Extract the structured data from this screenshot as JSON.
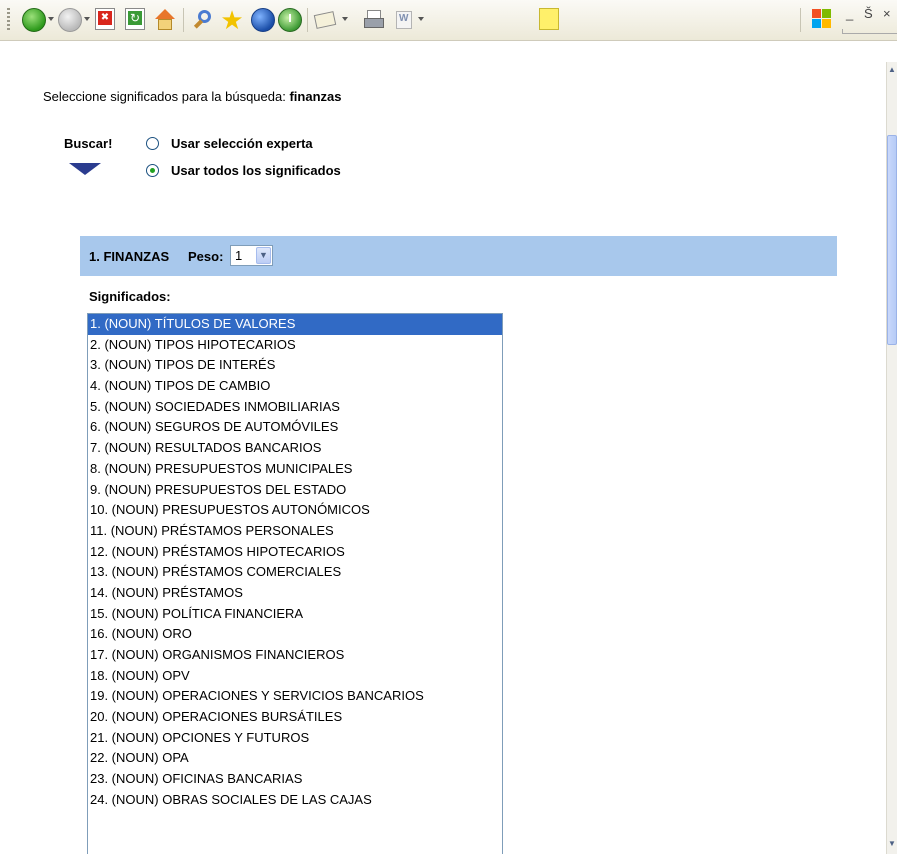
{
  "toolbar": {
    "buttons": [
      {
        "name": "back",
        "icon": "back-arrow-icon"
      },
      {
        "name": "forward",
        "icon": "forward-arrow-icon"
      },
      {
        "name": "stop",
        "icon": "stop-icon"
      },
      {
        "name": "refresh",
        "icon": "refresh-icon"
      },
      {
        "name": "home",
        "icon": "home-icon"
      },
      {
        "name": "search",
        "icon": "search-icon"
      },
      {
        "name": "favorites",
        "icon": "star-icon"
      },
      {
        "name": "media",
        "icon": "media-icon"
      },
      {
        "name": "history",
        "icon": "history-icon"
      },
      {
        "name": "mail",
        "icon": "mail-icon"
      },
      {
        "name": "print",
        "icon": "printer-icon"
      },
      {
        "name": "edit",
        "icon": "word-icon"
      },
      {
        "name": "notes",
        "icon": "note-icon"
      }
    ],
    "window_controls": {
      "minimize": "_",
      "restore": "Š",
      "close": "×"
    }
  },
  "page": {
    "intro_text": "Seleccione significados para la búsqueda: ",
    "query": "finanzas",
    "buscar_label": "Buscar!",
    "options": [
      {
        "label": "Usar selección experta",
        "checked": false
      },
      {
        "label": "Usar todos los significados",
        "checked": true
      }
    ],
    "section": {
      "title": "1. FINANZAS",
      "peso_label": "Peso:",
      "peso_value": "1"
    },
    "significados_label": "Significados:",
    "meanings": [
      "1. (NOUN) TÍTULOS DE VALORES",
      "2. (NOUN) TIPOS HIPOTECARIOS",
      "3. (NOUN) TIPOS DE INTERÉS",
      "4. (NOUN) TIPOS DE CAMBIO",
      "5. (NOUN) SOCIEDADES INMOBILIARIAS",
      "6. (NOUN) SEGUROS DE AUTOMÓVILES",
      "7. (NOUN) RESULTADOS BANCARIOS",
      "8. (NOUN) PRESUPUESTOS MUNICIPALES",
      "9. (NOUN) PRESUPUESTOS DEL ESTADO",
      "10. (NOUN) PRESUPUESTOS AUTONÓMICOS",
      "11. (NOUN) PRÉSTAMOS PERSONALES",
      "12. (NOUN) PRÉSTAMOS HIPOTECARIOS",
      "13. (NOUN) PRÉSTAMOS COMERCIALES",
      "14. (NOUN) PRÉSTAMOS",
      "15. (NOUN) POLÍTICA FINANCIERA",
      "16. (NOUN) ORO",
      "17. (NOUN) ORGANISMOS FINANCIEROS",
      "18. (NOUN) OPV",
      "19. (NOUN) OPERACIONES Y SERVICIOS BANCARIOS",
      "20. (NOUN) OPERACIONES BURSÁTILES",
      "21. (NOUN) OPCIONES Y FUTUROS",
      "22. (NOUN) OPA",
      "23. (NOUN) OFICINAS BANCARIAS",
      "24. (NOUN) OBRAS SOCIALES DE LAS CAJAS"
    ],
    "selected_index": 0
  }
}
